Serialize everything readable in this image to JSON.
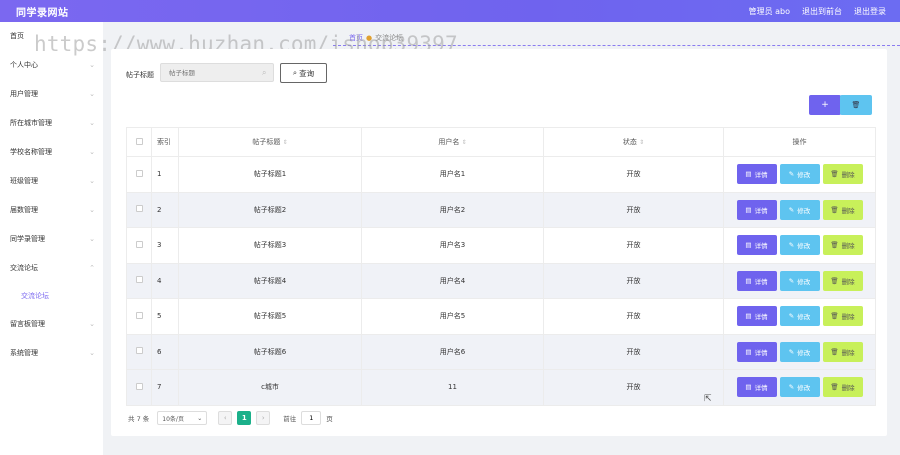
{
  "header": {
    "brand": "同学录网站",
    "admin_label": "管理员 abo",
    "back_to_console": "退出到前台",
    "logout": "退出登录"
  },
  "sidebar": {
    "items": [
      {
        "label": "首页"
      },
      {
        "label": "个人中心"
      },
      {
        "label": "用户管理"
      },
      {
        "label": "所在城市管理"
      },
      {
        "label": "学校名称管理"
      },
      {
        "label": "班级管理"
      },
      {
        "label": "届数管理"
      },
      {
        "label": "同学录管理"
      },
      {
        "label": "交流论坛"
      },
      {
        "label": "留言板管理"
      },
      {
        "label": "系统管理"
      }
    ],
    "active_sub": "交流论坛"
  },
  "watermark": "https://www.huzhan.com/ishop39397",
  "breadcrumb": {
    "current": "首页",
    "page": "交流论坛"
  },
  "search": {
    "label": "帖子标题",
    "placeholder": "帖子标题",
    "button": "查询"
  },
  "table": {
    "headers": {
      "index": "索引",
      "title": "帖子标题",
      "username": "用户名",
      "status": "状态",
      "actions": "操作"
    },
    "rows": [
      {
        "index": "1",
        "title": "帖子标题1",
        "username": "用户名1",
        "status": "开放"
      },
      {
        "index": "2",
        "title": "帖子标题2",
        "username": "用户名2",
        "status": "开放"
      },
      {
        "index": "3",
        "title": "帖子标题3",
        "username": "用户名3",
        "status": "开放"
      },
      {
        "index": "4",
        "title": "帖子标题4",
        "username": "用户名4",
        "status": "开放"
      },
      {
        "index": "5",
        "title": "帖子标题5",
        "username": "用户名5",
        "status": "开放"
      },
      {
        "index": "6",
        "title": "帖子标题6",
        "username": "用户名6",
        "status": "开放"
      },
      {
        "index": "7",
        "title": "c城市",
        "username": "11",
        "status": "开放"
      }
    ],
    "action_labels": {
      "detail": "详情",
      "edit": "修改",
      "delete": "删除"
    }
  },
  "pagination": {
    "total": "共 7 条",
    "page_size": "10条/页",
    "current_page": "1",
    "goto_label": "前往",
    "goto_value": "1",
    "page_suffix": "页"
  },
  "colors": {
    "primary": "#6f63ee",
    "info": "#5ec4f0",
    "warning": "#c8f05a",
    "pager_active": "#1bb08a"
  }
}
